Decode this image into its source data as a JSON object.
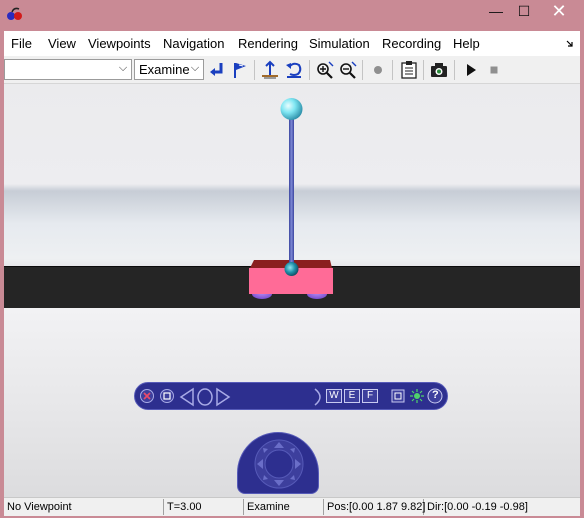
{
  "window": {
    "controls": {
      "minimize": "—",
      "maximize": "☐",
      "close": "✕"
    }
  },
  "menu": {
    "items": [
      "File",
      "View",
      "Viewpoints",
      "Navigation",
      "Rendering",
      "Simulation",
      "Recording",
      "Help"
    ]
  },
  "toolbar": {
    "viewpoint_combo_value": "",
    "navigation_mode": "Examine"
  },
  "navigator": {
    "wef_buttons": [
      "W",
      "E",
      "F"
    ],
    "help_label": "?"
  },
  "status": {
    "viewpoint": "No Viewpoint",
    "time": "T=3.00",
    "mode": "Examine",
    "position": "Pos:[0.00 1.87 9.82]",
    "direction": "Dir:[0.00 -0.19 -0.98]"
  },
  "colors": {
    "title_bar": "#c98a95",
    "cart_body": "#ff6b97",
    "cart_top": "#8a1f1f",
    "pole": "#5b68b8",
    "pole_ball": "#7fe6f2",
    "nav_panel": "#2d2f8f"
  }
}
